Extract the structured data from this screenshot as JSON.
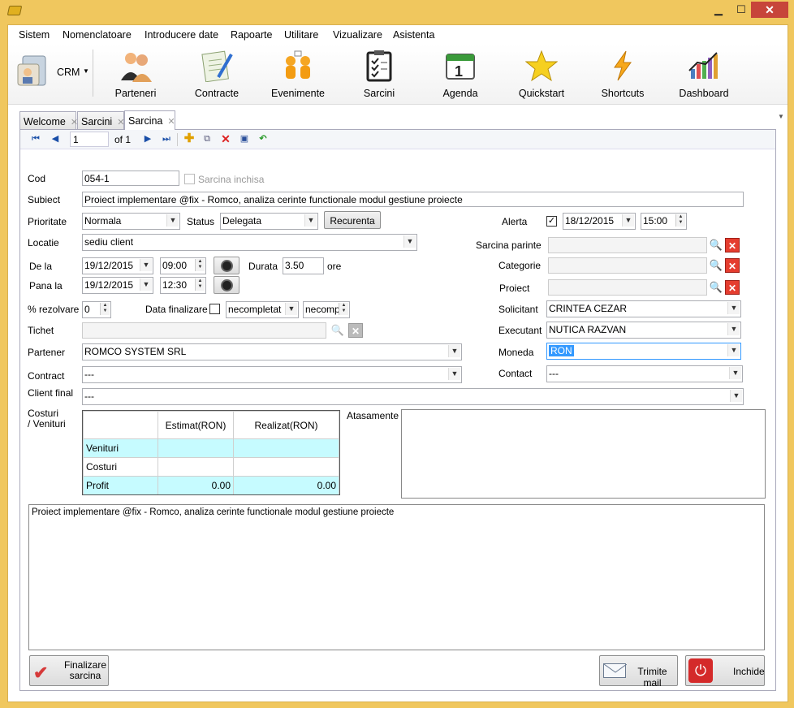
{
  "window": {
    "minimize": "▁",
    "maximize": "☐",
    "close": "✕"
  },
  "menu": [
    "Sistem",
    "Nomenclatoare",
    "Introducere date",
    "Rapoarte",
    "Utilitare",
    "Vizualizare",
    "Asistenta"
  ],
  "toolbar": {
    "crm_label": "CRM",
    "buttons": [
      {
        "label": "Parteneri",
        "icon": "users-icon"
      },
      {
        "label": "Contracte",
        "icon": "contract-icon"
      },
      {
        "label": "Evenimente",
        "icon": "events-icon"
      },
      {
        "label": "Sarcini",
        "icon": "tasks-icon"
      },
      {
        "label": "Agenda",
        "icon": "calendar-icon"
      },
      {
        "label": "Quickstart",
        "icon": "star-icon"
      },
      {
        "label": "Shortcuts",
        "icon": "lightning-icon"
      },
      {
        "label": "Dashboard",
        "icon": "chart-icon"
      }
    ]
  },
  "tabs": [
    {
      "label": "Welcome"
    },
    {
      "label": "Sarcini"
    },
    {
      "label": "Sarcina"
    }
  ],
  "nav": {
    "record": "1",
    "of": "of 1"
  },
  "form": {
    "cod_label": "Cod",
    "cod": "054-1",
    "inchisa_label": "Sarcina inchisa",
    "subiect_label": "Subiect",
    "subiect": "Proiect implementare @fix - Romco, analiza cerinte functionale modul gestiune proiecte",
    "prioritate_label": "Prioritate",
    "prioritate": "Normala",
    "status_label": "Status",
    "status": "Delegata",
    "recurenta": "Recurenta",
    "alerta_label": "Alerta",
    "alerta_checked": "✓",
    "alerta_date": "18/12/2015",
    "alerta_time": "15:00",
    "locatie_label": "Locatie",
    "locatie": "sediu client",
    "parinte_label": "Sarcina parinte",
    "dela_label": "De la",
    "dela_date": "19/12/2015",
    "dela_time": "09:00",
    "durata_label": "Durata",
    "durata": "3.50",
    "ore": "ore",
    "categorie_label": "Categorie",
    "panala_label": "Pana la",
    "panala_date": "19/12/2015",
    "panala_time": "12:30",
    "proiect_label": "Proiect",
    "rezolvare_label": "% rezolvare",
    "rezolvare": "0",
    "finalizare_label": "Data finalizare",
    "finalizare_1": "necompletat",
    "finalizare_2": "necompl",
    "solicitant_label": "Solicitant",
    "solicitant": "CRINTEA CEZAR",
    "tichet_label": "Tichet",
    "executant_label": "Executant",
    "executant": "NUTICA RAZVAN",
    "partener_label": "Partener",
    "partener": "ROMCO SYSTEM SRL",
    "moneda_label": "Moneda",
    "moneda": "RON",
    "contract_label": "Contract",
    "contract": "---",
    "contact_label": "Contact",
    "contact": "---",
    "client_final_label": "Client final",
    "client_final": "---",
    "costuri_label": "Costuri\n/ Venituri",
    "atasamente_label": "Atasamente",
    "notes": "Proiect implementare @fix - Romco, analiza cerinte functionale modul gestiune proiecte"
  },
  "costs": {
    "headers": [
      "",
      "Estimat(RON)",
      "Realizat(RON)"
    ],
    "rows": [
      [
        "Venituri",
        "",
        ""
      ],
      [
        "Costuri",
        "",
        ""
      ],
      [
        "Profit",
        "0.00",
        "0.00"
      ]
    ]
  },
  "footer": {
    "finalizare": "Finalizare\nsarcina",
    "trimite": "Trimite mail",
    "inchide": "Inchide"
  }
}
